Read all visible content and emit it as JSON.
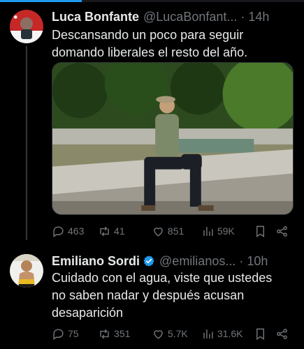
{
  "colors": {
    "background": "#000000",
    "text": "#e7e9ea",
    "muted": "#71767b",
    "accent": "#1d9bf0"
  },
  "tweets": [
    {
      "name": "Luca Bonfante",
      "handle": "@LucaBonfant...",
      "separator": "·",
      "time": "14h",
      "verified": false,
      "text_lines": [
        "Descansando un poco para seguir",
        "domando liberales el resto del año."
      ],
      "has_media": true,
      "stats": {
        "replies": "463",
        "retweets": "41",
        "likes": "851",
        "views": "59K"
      }
    },
    {
      "name": "Emiliano Sordi",
      "handle": "@emilianos...",
      "separator": "·",
      "time": "10h",
      "verified": true,
      "text_lines": [
        "Cuidado con el agua, viste que ustedes",
        "no saben nadar y después acusan",
        "desaparición"
      ],
      "has_media": false,
      "stats": {
        "replies": "75",
        "retweets": "351",
        "likes": "5.7K",
        "views": "31.6K"
      }
    }
  ],
  "icons": [
    "reply-icon",
    "retweet-icon",
    "like-icon",
    "views-icon",
    "bookmark-icon",
    "share-icon",
    "verified-badge-icon"
  ]
}
